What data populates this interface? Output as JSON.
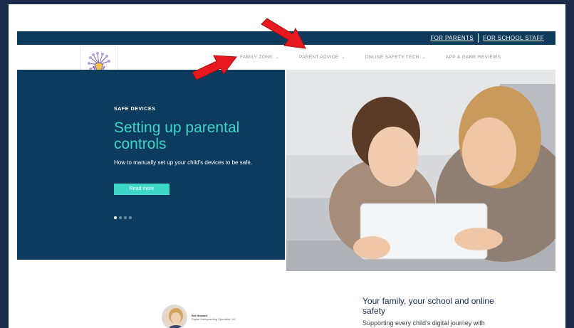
{
  "topbar": {
    "links": [
      "FOR PARENTS",
      "FOR SCHOOL STAFF"
    ]
  },
  "nav": {
    "items": [
      {
        "label": "FAMILY ZONE",
        "has_dropdown": true
      },
      {
        "label": "PARENT ADVICE",
        "has_dropdown": true
      },
      {
        "label": "ONLINE SAFETY TECH",
        "has_dropdown": true
      },
      {
        "label": "APP & GAME REVIEWS",
        "has_dropdown": false
      }
    ]
  },
  "hero": {
    "kicker": "SAFE DEVICES",
    "title": "Setting up parental controls",
    "description": "How to manually set up your child's devices to be safe.",
    "button": "Read more",
    "dots": 4,
    "active_dot": 0
  },
  "profile": {
    "name": "Bel Howard",
    "role": "Digital Safeguarding Specialist, UK"
  },
  "bottom": {
    "title": "Your family, your school and online safety",
    "text": "Supporting every child's digital journey with"
  },
  "colors": {
    "background": "#1b2a49",
    "primary": "#0d3b5e",
    "accent": "#3ed6c6",
    "arrow": "#e8191e"
  }
}
